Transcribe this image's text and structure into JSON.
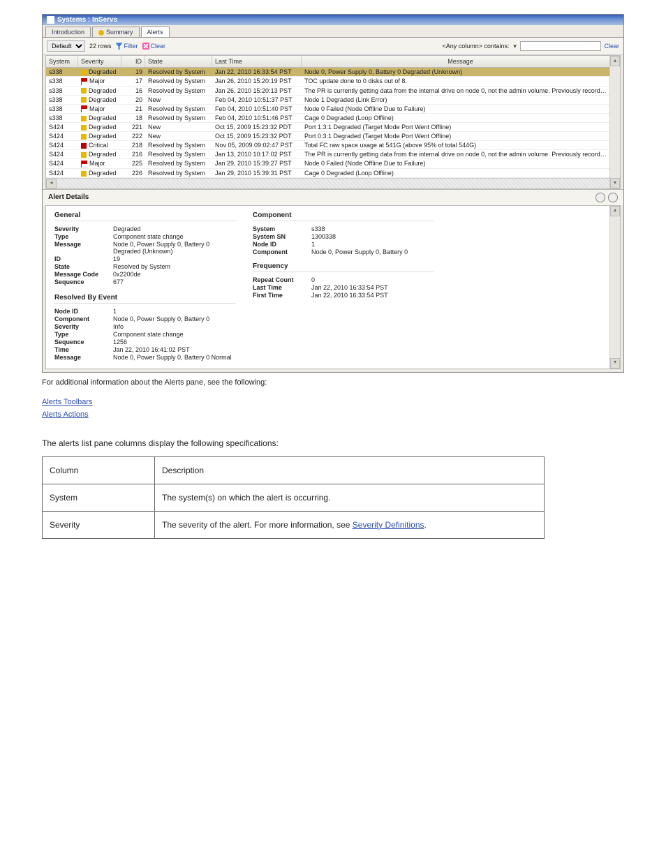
{
  "figure": {
    "titlebar": "Systems : InServs",
    "tabs": {
      "intro": "Introduction",
      "summary": "Summary",
      "alerts": "Alerts"
    },
    "toolbar": {
      "filter_default": "Default",
      "row_count": "22 rows",
      "filter": "Filter",
      "clear_tb": "Clear",
      "any_column": "<Any column> contains:",
      "clear_link": "Clear"
    },
    "columns": {
      "system": "System",
      "severity": "Severity",
      "id": "ID",
      "state": "State",
      "lasttime": "Last Time",
      "message": "Message"
    },
    "rows": [
      {
        "sys": "s338",
        "sev": "Degraded",
        "sico": "deg",
        "id": "19",
        "state": "Resolved by System",
        "time": "Jan 22, 2010 16:33:54 PST",
        "msg": "Node 0, Power Supply 0, Battery 0 Degraded (Unknown)",
        "sel": true
      },
      {
        "sys": "s338",
        "sev": "Major",
        "sico": "maj",
        "id": "17",
        "state": "Resolved by System",
        "time": "Jan 26, 2010 15:20:19 PST",
        "msg": "TOC update done to 0 disks out of 8."
      },
      {
        "sys": "s338",
        "sev": "Degraded",
        "sico": "deg",
        "id": "16",
        "state": "Resolved by System",
        "time": "Jan 26, 2010 15:20:13 PST",
        "msg": "The PR is currently getting data from the internal drive on node 0, not the admin volume. Previously recorded alerts will not be"
      },
      {
        "sys": "s338",
        "sev": "Degraded",
        "sico": "deg",
        "id": "20",
        "state": "New",
        "time": "Feb 04, 2010 10:51:37 PST",
        "msg": "Node 1 Degraded (Link Error)"
      },
      {
        "sys": "s338",
        "sev": "Major",
        "sico": "maj",
        "id": "21",
        "state": "Resolved by System",
        "time": "Feb 04, 2010 10:51:40 PST",
        "msg": "Node 0 Failed (Node Offline Due to Failure)"
      },
      {
        "sys": "s338",
        "sev": "Degraded",
        "sico": "deg",
        "id": "18",
        "state": "Resolved by System",
        "time": "Feb 04, 2010 10:51:46 PST",
        "msg": "Cage 0 Degraded (Loop Offline)"
      },
      {
        "sys": "S424",
        "sev": "Degraded",
        "sico": "deg",
        "id": "221",
        "state": "New",
        "time": "Oct 15, 2009 15:23:32 PDT",
        "msg": "Port 1:3:1 Degraded (Target Mode Port Went Offline)"
      },
      {
        "sys": "S424",
        "sev": "Degraded",
        "sico": "deg",
        "id": "222",
        "state": "New",
        "time": "Oct 15, 2009 15:23:32 PDT",
        "msg": "Port 0:3:1 Degraded (Target Mode Port Went Offline)"
      },
      {
        "sys": "S424",
        "sev": "Critical",
        "sico": "crit",
        "id": "218",
        "state": "Resolved by System",
        "time": "Nov 05, 2009 09:02:47 PST",
        "msg": "Total FC raw space usage at 541G (above 95% of total 544G)"
      },
      {
        "sys": "S424",
        "sev": "Degraded",
        "sico": "deg",
        "id": "216",
        "state": "Resolved by System",
        "time": "Jan 13, 2010 10:17:02 PST",
        "msg": "The PR is currently getting data from the internal drive on node 0, not the admin volume. Previously recorded alerts will not be"
      },
      {
        "sys": "S424",
        "sev": "Major",
        "sico": "maj",
        "id": "225",
        "state": "Resolved by System",
        "time": "Jan 29, 2010 15:39:27 PST",
        "msg": "Node 0 Failed (Node Offline Due to Failure)"
      },
      {
        "sys": "S424",
        "sev": "Degraded",
        "sico": "deg",
        "id": "226",
        "state": "Resolved by System",
        "time": "Jan 29, 2010 15:39:31 PST",
        "msg": "Cage 0 Degraded (Loop Offline)"
      }
    ],
    "details_header": "Alert Details",
    "general": {
      "title": "General",
      "severity_k": "Severity",
      "severity_v": "Degraded",
      "type_k": "Type",
      "type_v": "Component state change",
      "message_k": "Message",
      "message_v": "Node 0, Power Supply 0, Battery 0 Degraded (Unknown)",
      "id_k": "ID",
      "id_v": "19",
      "state_k": "State",
      "state_v": "Resolved by System",
      "code_k": "Message Code",
      "code_v": "0x2200de",
      "seq_k": "Sequence",
      "seq_v": "677"
    },
    "component": {
      "title": "Component",
      "system_k": "System",
      "system_v": "s338",
      "sn_k": "System SN",
      "sn_v": "1300338",
      "node_k": "Node ID",
      "node_v": "1",
      "comp_k": "Component",
      "comp_v": "Node 0, Power Supply 0, Battery 0",
      "freq_title": "Frequency",
      "rc_k": "Repeat Count",
      "rc_v": "0",
      "lt_k": "Last Time",
      "lt_v": "Jan 22, 2010 16:33:54 PST",
      "ft_k": "First Time",
      "ft_v": "Jan 22, 2010 16:33:54 PST"
    },
    "resolved": {
      "title": "Resolved By Event",
      "node_k": "Node ID",
      "node_v": "1",
      "comp_k": "Component",
      "comp_v": "Node 0, Power Supply 0, Battery 0",
      "sev_k": "Severity",
      "sev_v": "Info",
      "type_k": "Type",
      "type_v": "Component state change",
      "seq_k": "Sequence",
      "seq_v": "1256",
      "time_k": "Time",
      "time_v": "Jan 22, 2010 16:41:02 PST",
      "msg_k": "Message",
      "msg_v": "Node 0, Power Supply 0, Battery 0 Normal"
    }
  },
  "caption": "For additional information about the Alerts pane, see the following:",
  "toc": {
    "l1": "Alerts Toolbars",
    "l2": "Alerts Actions"
  },
  "spec": {
    "intro": "The alerts list pane columns display the following specifications:",
    "rows": [
      {
        "c1": "Column",
        "c2": "Description"
      },
      {
        "c1": "System",
        "c2": "The system(s) on which the alert is occurring."
      },
      {
        "c1": "Severity",
        "c2_prefix": "The severity of the alert. For more information, see ",
        "c2_link": "Severity Definitions",
        "c2_suffix": "."
      }
    ]
  }
}
